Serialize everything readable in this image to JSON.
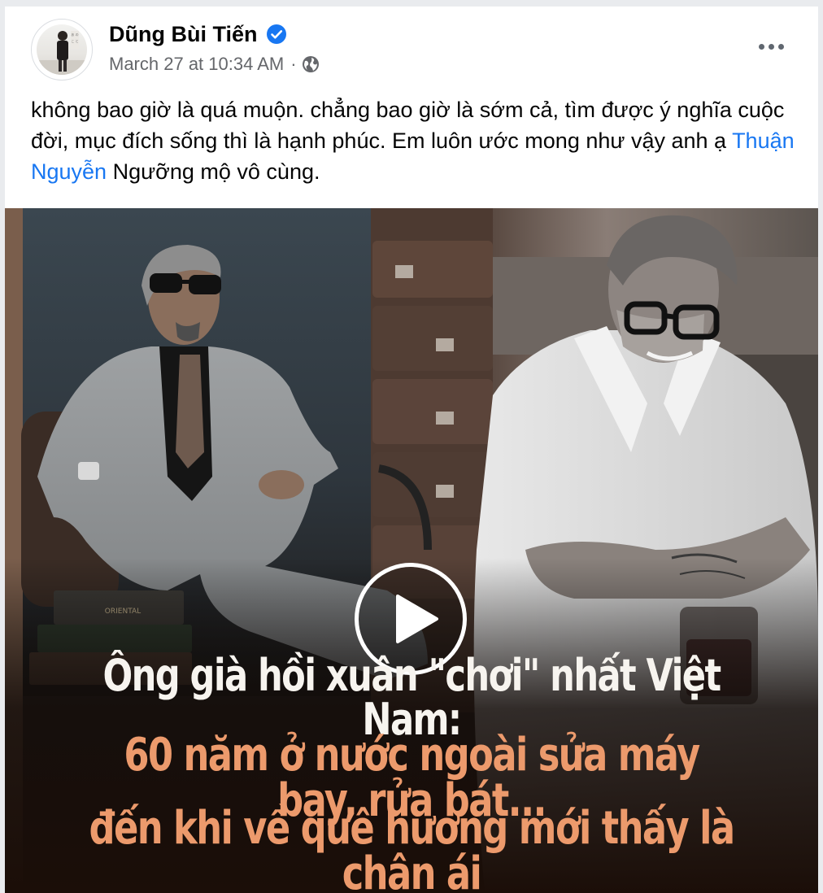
{
  "post": {
    "author_name": "Dũng Bùi Tiến",
    "timestamp": "March 27 at 10:34 AM",
    "meta_separator": "·",
    "audience_icon": "globe-icon",
    "verified_icon": "verified-badge-icon",
    "more_icon": "more-options-icon",
    "text_part1": "không bao giờ là quá muộn. chẳng bao giờ là sớm cả, tìm được ý nghĩa cuộc đời, mục đích sống thì là hạnh phúc. Em luôn ước mong như vậy anh ạ ",
    "mention": "Thuận Nguyễn",
    "text_part2": " Ngưỡng mộ vô cùng."
  },
  "video": {
    "play_icon": "play-icon",
    "headline_line1": "Ông già hồi xuân \"chơi\" nhất Việt Nam:",
    "headline_line2": "60 năm ở nước ngoài sửa máy bay, rửa bát...",
    "headline_line3": "đến khi về quê hương mới thấy là chân ái"
  },
  "colors": {
    "link": "#1877f2",
    "verified": "#1877f2",
    "headline_white": "#f7f4ef",
    "headline_orange": "#ec9a6c",
    "meta_gray": "#65676b"
  }
}
